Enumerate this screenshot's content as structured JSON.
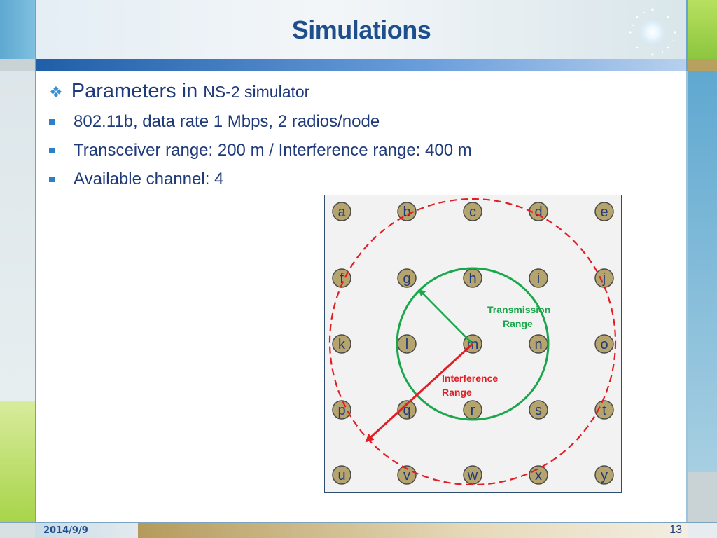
{
  "slide": {
    "title": "Simulations",
    "heading": {
      "marker_icon": "diamond-bullet-icon",
      "main": "Parameters in",
      "secondary": "NS-2 simulator"
    },
    "bullets": [
      "802.11b, data rate 1 Mbps, 2 radios/node",
      "Transceiver range: 200 m / Interference range: 400 m",
      "Available channel: 4"
    ],
    "diagram": {
      "node_labels": [
        [
          "a",
          "b",
          "c",
          "d",
          "e"
        ],
        [
          "f",
          "g",
          "h",
          "i",
          "j"
        ],
        [
          "k",
          "l",
          "m",
          "n",
          "o"
        ],
        [
          "p",
          "q",
          "r",
          "s",
          "t"
        ],
        [
          "u",
          "v",
          "w",
          "x",
          "y"
        ]
      ],
      "transmission_label": [
        "Transmission",
        "Range"
      ],
      "interference_label": [
        "Interference",
        "Range"
      ],
      "colors": {
        "transmission": "#1aa64a",
        "interference": "#e01e24",
        "node_fill": "#b5a46e",
        "node_stroke": "#4a4a4a",
        "panel_fill": "#f2f2f2",
        "panel_stroke": "#2f4d6e"
      }
    }
  },
  "footer": {
    "date": "2014/9/9",
    "page_number": "13"
  }
}
